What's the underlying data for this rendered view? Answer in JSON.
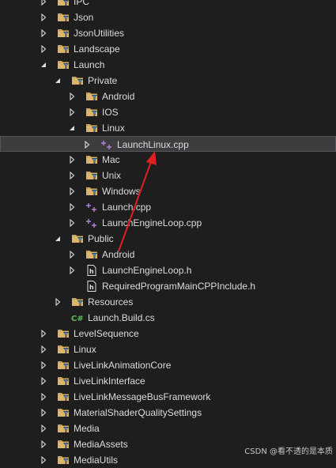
{
  "tree": [
    {
      "label": "IPC",
      "depth": 0,
      "kind": "filter",
      "state": "collapsed"
    },
    {
      "label": "Json",
      "depth": 0,
      "kind": "filter",
      "state": "collapsed"
    },
    {
      "label": "JsonUtilities",
      "depth": 0,
      "kind": "filter",
      "state": "collapsed"
    },
    {
      "label": "Landscape",
      "depth": 0,
      "kind": "filter",
      "state": "collapsed"
    },
    {
      "label": "Launch",
      "depth": 0,
      "kind": "filter",
      "state": "expanded"
    },
    {
      "label": "Private",
      "depth": 1,
      "kind": "filter",
      "state": "expanded"
    },
    {
      "label": "Android",
      "depth": 2,
      "kind": "filter",
      "state": "collapsed"
    },
    {
      "label": "IOS",
      "depth": 2,
      "kind": "filter",
      "state": "collapsed"
    },
    {
      "label": "Linux",
      "depth": 2,
      "kind": "filter",
      "state": "expanded"
    },
    {
      "label": "LaunchLinux.cpp",
      "depth": 3,
      "kind": "cpp",
      "state": "collapsed",
      "selected": true
    },
    {
      "label": "Mac",
      "depth": 2,
      "kind": "filter",
      "state": "collapsed"
    },
    {
      "label": "Unix",
      "depth": 2,
      "kind": "filter",
      "state": "collapsed"
    },
    {
      "label": "Windows",
      "depth": 2,
      "kind": "filter",
      "state": "collapsed"
    },
    {
      "label": "Launch.cpp",
      "depth": 2,
      "kind": "cpp",
      "state": "collapsed"
    },
    {
      "label": "LaunchEngineLoop.cpp",
      "depth": 2,
      "kind": "cpp",
      "state": "collapsed"
    },
    {
      "label": "Public",
      "depth": 1,
      "kind": "filter",
      "state": "expanded"
    },
    {
      "label": "Android",
      "depth": 2,
      "kind": "filter",
      "state": "collapsed"
    },
    {
      "label": "LaunchEngineLoop.h",
      "depth": 2,
      "kind": "header",
      "state": "collapsed"
    },
    {
      "label": "RequiredProgramMainCPPInclude.h",
      "depth": 2,
      "kind": "header",
      "state": "none"
    },
    {
      "label": "Resources",
      "depth": 1,
      "kind": "filter",
      "state": "collapsed"
    },
    {
      "label": "Launch.Build.cs",
      "depth": 1,
      "kind": "csharp",
      "state": "none"
    },
    {
      "label": "LevelSequence",
      "depth": 0,
      "kind": "filter",
      "state": "collapsed"
    },
    {
      "label": "Linux",
      "depth": 0,
      "kind": "filter",
      "state": "collapsed"
    },
    {
      "label": "LiveLinkAnimationCore",
      "depth": 0,
      "kind": "filter",
      "state": "collapsed"
    },
    {
      "label": "LiveLinkInterface",
      "depth": 0,
      "kind": "filter",
      "state": "collapsed"
    },
    {
      "label": "LiveLinkMessageBusFramework",
      "depth": 0,
      "kind": "filter",
      "state": "collapsed"
    },
    {
      "label": "MaterialShaderQualitySettings",
      "depth": 0,
      "kind": "filter",
      "state": "collapsed"
    },
    {
      "label": "Media",
      "depth": 0,
      "kind": "filter",
      "state": "collapsed"
    },
    {
      "label": "MediaAssets",
      "depth": 0,
      "kind": "filter",
      "state": "collapsed"
    },
    {
      "label": "MediaUtils",
      "depth": 0,
      "kind": "filter",
      "state": "collapsed"
    }
  ],
  "watermark": "CSDN @看不透的是本质",
  "colors": {
    "background": "#1e1e1e",
    "text": "#dcdcdc",
    "folder": "#c9a45c",
    "filter_funnel": "#3c8cd8",
    "cpp_plus": "#b180d7",
    "csharp": "#5cb85c",
    "annotation_arrow": "#e02020",
    "selected_bg": "#3d3d40"
  },
  "icons": {
    "filter": "filter-folder-icon",
    "cpp": "cpp-file-icon",
    "header": "header-file-icon",
    "csharp": "csharp-file-icon"
  }
}
